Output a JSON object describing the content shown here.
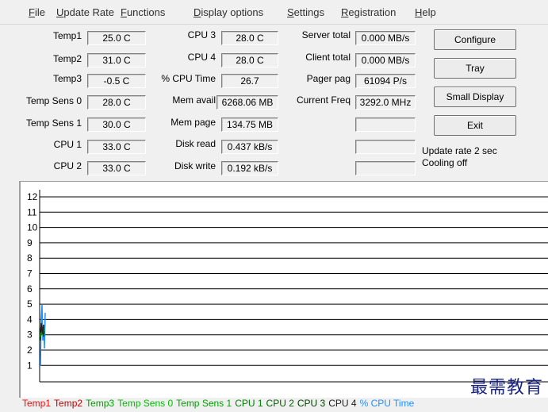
{
  "menu": [
    "File",
    "Update Rate",
    "Functions",
    "Display options",
    "Settings",
    "Registration",
    "Help"
  ],
  "col1": [
    {
      "label": "Temp1",
      "value": "25.0 C"
    },
    {
      "label": "Temp2",
      "value": "31.0 C"
    },
    {
      "label": "Temp3",
      "value": "-0.5 C"
    },
    {
      "label": "Temp Sens 0",
      "value": "28.0 C"
    },
    {
      "label": "Temp Sens 1",
      "value": "30.0 C"
    },
    {
      "label": "CPU 1",
      "value": "33.0 C"
    },
    {
      "label": "CPU 2",
      "value": "33.0 C"
    }
  ],
  "col2": [
    {
      "label": "CPU 3",
      "value": "28.0 C"
    },
    {
      "label": "CPU 4",
      "value": "28.0 C"
    },
    {
      "label": "% CPU Time",
      "value": "26.7"
    },
    {
      "label": "Mem avail",
      "value": "6268.06 MB"
    },
    {
      "label": "Mem page",
      "value": "134.75 MB"
    },
    {
      "label": "Disk read",
      "value": "0.437 kB/s"
    },
    {
      "label": "Disk write",
      "value": "0.192 kB/s"
    }
  ],
  "col3": [
    {
      "label": "Server total",
      "value": "0.000 MB/s"
    },
    {
      "label": "Client total",
      "value": "0.000 MB/s"
    },
    {
      "label": "Pager pag",
      "value": "61094 P/s"
    },
    {
      "label": "Current Freq",
      "value": "3292.0 MHz"
    },
    {
      "label": "",
      "value": ""
    },
    {
      "label": "",
      "value": ""
    },
    {
      "label": "",
      "value": ""
    }
  ],
  "buttons": {
    "configure": "Configure",
    "tray": "Tray",
    "small_display": "Small Display",
    "exit": "Exit"
  },
  "status": {
    "update_rate": "Update rate 2 sec",
    "cooling": "Cooling off"
  },
  "chart_data": {
    "type": "line",
    "y_ticks": [
      "12",
      "11",
      "10",
      "9",
      "8",
      "7",
      "6",
      "5",
      "4",
      "3",
      "2",
      "1"
    ],
    "ylim": [
      0,
      12.5
    ],
    "series_legend": [
      {
        "name": "Temp1",
        "color": "#ff0000"
      },
      {
        "name": "Temp2",
        "color": "#c00000"
      },
      {
        "name": "Temp3",
        "color": "#00a000"
      },
      {
        "name": "Temp Sens 0",
        "color": "#00c000"
      },
      {
        "name": "Temp Sens 1",
        "color": "#00a000"
      },
      {
        "name": "CPU 1",
        "color": "#008000"
      },
      {
        "name": "CPU 2",
        "color": "#006000"
      },
      {
        "name": "CPU 3",
        "color": "#004000"
      },
      {
        "name": "CPU 4",
        "color": "#202020"
      },
      {
        "name": "% CPU Time",
        "color": "#1e90ff"
      }
    ]
  },
  "watermark": "最需教育"
}
